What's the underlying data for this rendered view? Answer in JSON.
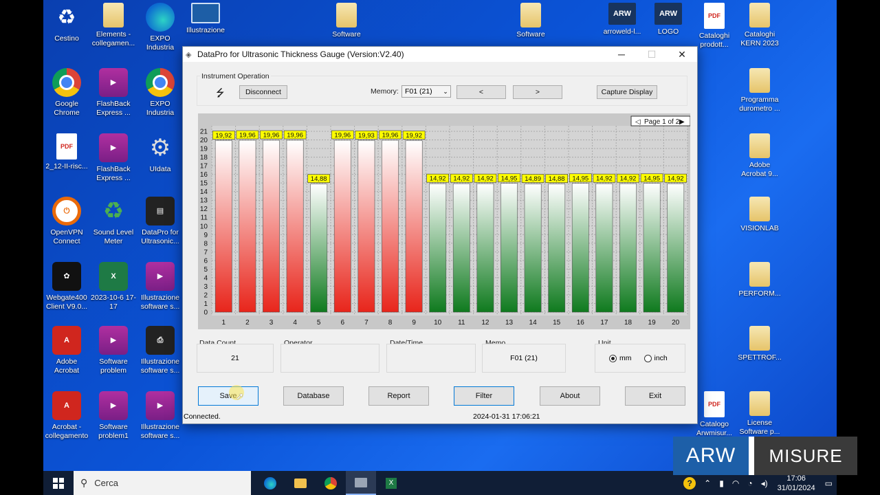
{
  "desktop_icons": [
    {
      "label": "Cestino",
      "icon": "recycle-bin-icon"
    },
    {
      "label": "Elements - collegamen...",
      "icon": "folder-icon"
    },
    {
      "label": "EXPO Industria",
      "icon": "edge-icon"
    },
    {
      "label": "Illustrazione",
      "icon": "film-icon"
    },
    {
      "label": "Software",
      "icon": "folder-icon"
    },
    {
      "label": "Software",
      "icon": "folder-icon"
    },
    {
      "label": "arroweld-l...",
      "icon": "arw-icon"
    },
    {
      "label": "LOGO",
      "icon": "arw-icon"
    },
    {
      "label": "Cataloghi prodott...",
      "icon": "pdf-icon"
    },
    {
      "label": "Cataloghi KERN 2023",
      "icon": "folder-icon"
    },
    {
      "label": "Google Chrome",
      "icon": "chrome-icon"
    },
    {
      "label": "FlashBack Express ...",
      "icon": "video-icon"
    },
    {
      "label": "EXPO Industria",
      "icon": "chrome-icon"
    },
    {
      "label": "Programma durometro ...",
      "icon": "folder-icon"
    },
    {
      "label": "2_12-II-risc...",
      "icon": "pdf-icon"
    },
    {
      "label": "FlashBack Express ...",
      "icon": "video-icon"
    },
    {
      "label": "UIdata",
      "icon": "gear-icon"
    },
    {
      "label": "Adobe Acrobat 9...",
      "icon": "folder-icon"
    },
    {
      "label": "OpenVPN Connect",
      "icon": "vpn-icon"
    },
    {
      "label": "Sound Level Meter",
      "icon": "recycle-green-icon"
    },
    {
      "label": "DataPro for Ultrasonic...",
      "icon": "device-icon"
    },
    {
      "label": "VISIONLAB",
      "icon": "folder-icon"
    },
    {
      "label": "Webgate400 Client V9.0...",
      "icon": "webgate-icon"
    },
    {
      "label": "2023-10-6 17-17",
      "icon": "excel-icon"
    },
    {
      "label": "Illustrazione software s...",
      "icon": "video-icon"
    },
    {
      "label": "PERFORM...",
      "icon": "folder-icon"
    },
    {
      "label": "Adobe Acrobat",
      "icon": "acrobat-icon"
    },
    {
      "label": "Software problem",
      "icon": "video-icon"
    },
    {
      "label": "Illustrazione software s...",
      "icon": "printer-icon"
    },
    {
      "label": "SPETTROF...",
      "icon": "folder-icon"
    },
    {
      "label": "Acrobat - collegamento",
      "icon": "acrobat-icon"
    },
    {
      "label": "Software problem1",
      "icon": "video-icon"
    },
    {
      "label": "Illustrazione software s...",
      "icon": "video-icon"
    },
    {
      "label": "Catalogo Arwmisur...",
      "icon": "pdf-icon"
    },
    {
      "label": "License Software p...",
      "icon": "folder-icon"
    }
  ],
  "window": {
    "title": "DataPro for Ultrasonic Thickness Gauge (Version:V2.40)",
    "instrument_group_label": "Instrument Operation",
    "disconnect_label": "Disconnect",
    "memory_label": "Memory:",
    "memory_value": "F01 (21)",
    "prev_label": "<",
    "next_label": ">",
    "capture_label": "Capture Display",
    "page_label": "Page 1 of 2",
    "fields": {
      "data_count_label": "Data Count",
      "data_count_value": "21",
      "operator_label": "Operator",
      "operator_value": "",
      "datetime_label": "Date/Time",
      "datetime_value": "",
      "memo_label": "Memo",
      "memo_value": "F01 (21)",
      "unit_label": "Unit",
      "unit_mm": "mm",
      "unit_inch": "inch"
    },
    "buttons": {
      "save": "Save",
      "database": "Database",
      "report": "Report",
      "filter": "Filter",
      "about": "About",
      "exit": "Exit"
    },
    "status_left": "Connected.",
    "status_datetime": "2024-01-31 17:06:21"
  },
  "chart_data": {
    "type": "bar",
    "categories": [
      "1",
      "2",
      "3",
      "4",
      "5",
      "6",
      "7",
      "8",
      "9",
      "10",
      "11",
      "12",
      "13",
      "14",
      "15",
      "16",
      "17",
      "18",
      "19",
      "20"
    ],
    "values": [
      19.92,
      19.96,
      19.96,
      19.96,
      14.88,
      19.96,
      19.93,
      19.96,
      19.92,
      14.92,
      14.92,
      14.92,
      14.95,
      14.89,
      14.88,
      14.95,
      14.92,
      14.92,
      14.95,
      14.92
    ],
    "value_labels": [
      "19,92",
      "19,96",
      "19,96",
      "19,96",
      "14,88",
      "19,96",
      "19,93",
      "19,96",
      "19,92",
      "14,92",
      "14,92",
      "14,92",
      "14,95",
      "14,89",
      "14,88",
      "14,95",
      "14,92",
      "14,92",
      "14,95",
      "14,92"
    ],
    "bar_colors": [
      "red",
      "red",
      "red",
      "red",
      "green",
      "red",
      "red",
      "red",
      "red",
      "green",
      "green",
      "green",
      "green",
      "green",
      "green",
      "green",
      "green",
      "green",
      "green",
      "green"
    ],
    "ylim": [
      0,
      21
    ],
    "yticks": [
      "0",
      "1",
      "2",
      "3",
      "4",
      "5",
      "6",
      "7",
      "8",
      "9",
      "10",
      "11",
      "12",
      "13",
      "14",
      "15",
      "16",
      "17",
      "18",
      "19",
      "20",
      "21"
    ],
    "grid": true,
    "colors": {
      "red": "#e8251b",
      "green": "#0f7a1e",
      "label_bg": "#ffff00"
    }
  },
  "taskbar": {
    "search_placeholder": "Cerca",
    "time": "17:06",
    "date": "31/01/2024"
  },
  "watermark": {
    "left": "ARW",
    "right": "MISURE"
  }
}
